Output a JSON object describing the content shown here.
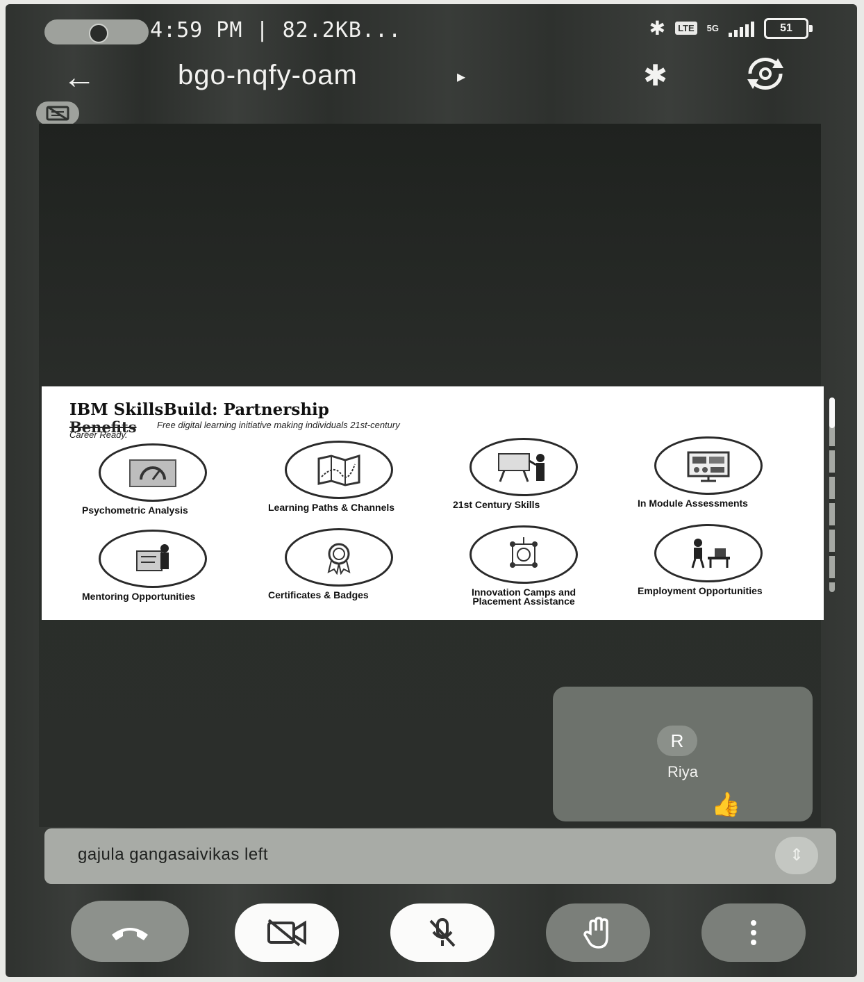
{
  "status_bar": {
    "time": "4:59 PM | 82.2KB...",
    "network": "5G",
    "lte": "LTE",
    "battery": "51"
  },
  "header": {
    "meeting_code": "bgo-nqfy-oam",
    "caret": "▸"
  },
  "slide": {
    "title": "IBM SkillsBuild: Partnership",
    "title_line2": "Benefits",
    "subtitle": "Free digital learning initiative making individuals 21st-century",
    "subtitle_line2": "Career Ready.",
    "benefits": [
      {
        "label": "Psychometric Analysis",
        "icon": "gauge-chart-icon"
      },
      {
        "label": "Learning Paths & Channels",
        "icon": "map-icon"
      },
      {
        "label": "21st Century Skills",
        "icon": "presentation-board-icon"
      },
      {
        "label": "In Module Assessments",
        "icon": "dashboard-screen-icon"
      },
      {
        "label": "Mentoring Opportunities",
        "icon": "mentor-icon"
      },
      {
        "label": "Certificates & Badges",
        "icon": "badge-ribbon-icon"
      },
      {
        "label": "Innovation Camps and Placement Assistance",
        "icon": "network-target-icon"
      },
      {
        "label": "Employment Opportunities",
        "icon": "office-worker-icon"
      }
    ]
  },
  "participant": {
    "initial": "R",
    "name": "Riya"
  },
  "notification": {
    "text": "gajula gangasaivikas left"
  },
  "controls": {
    "end_call": "end-call-icon",
    "camera": "camera-off-icon",
    "mic": "mic-off-icon",
    "raise_hand": "hand-icon",
    "more": "more-vertical-icon"
  },
  "colors": {
    "background": "#2f322f",
    "tile": "#6d726c",
    "notification": "#a8aba6",
    "control_dark": "#7b7f7a",
    "control_light": "#fbfbfa"
  }
}
